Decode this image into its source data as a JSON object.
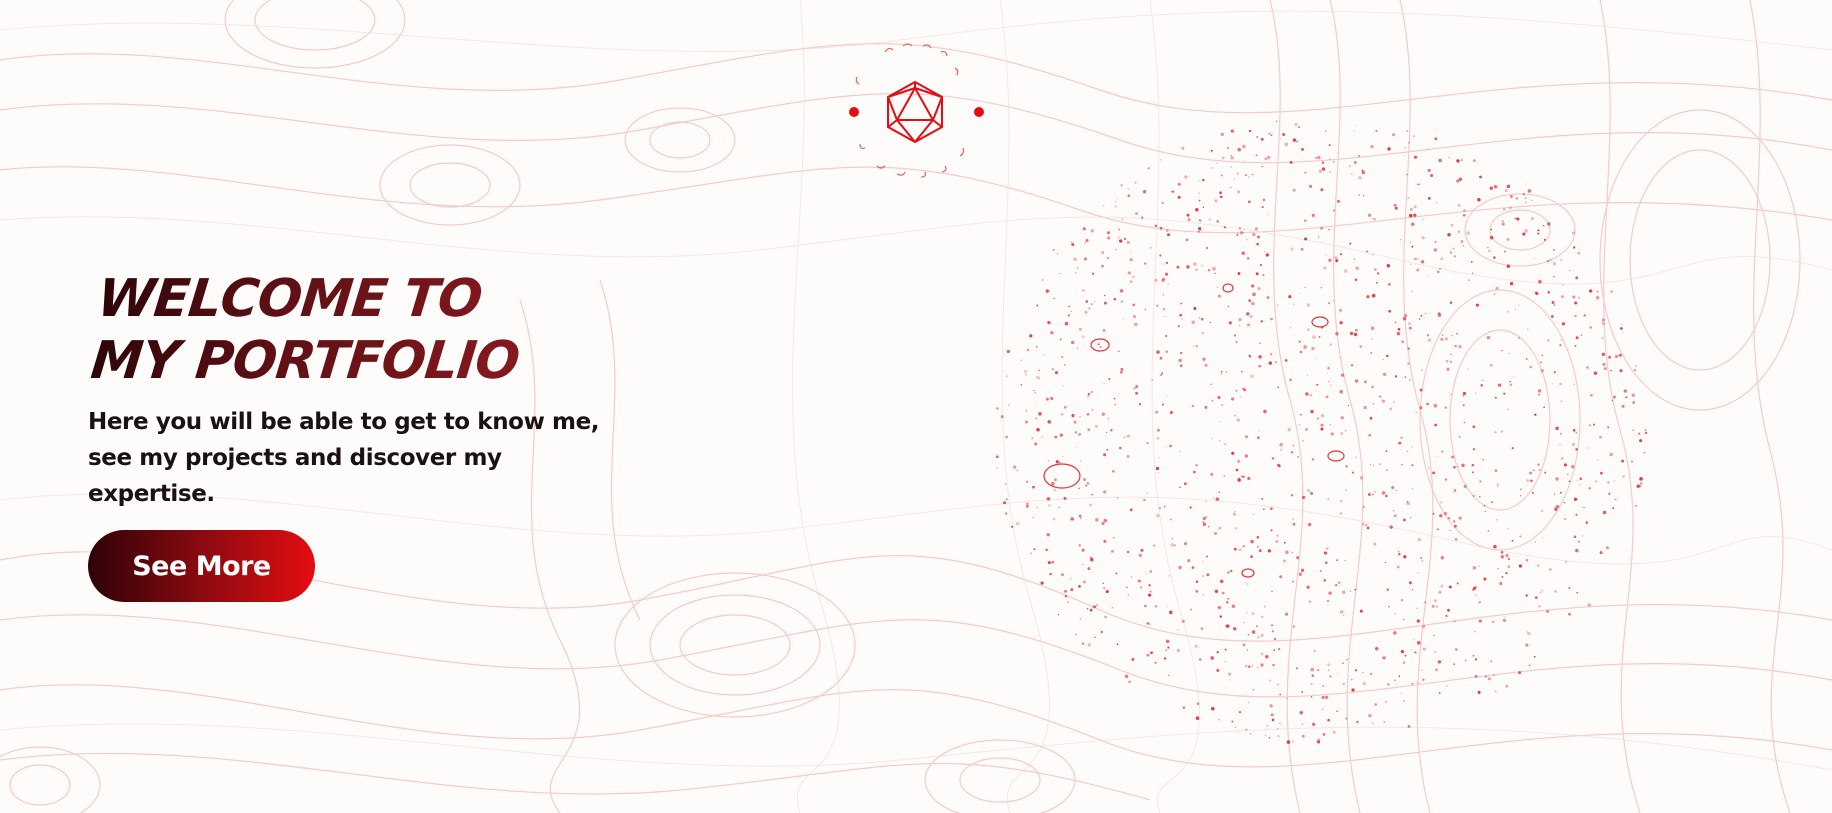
{
  "hero": {
    "title": "Welcome to my portfolio",
    "subtitle": "Here you will be able to get to know me, see my projects and discover my expertise."
  },
  "cta": {
    "label": "See More"
  },
  "logo": {
    "icon": "icosahedron-icon"
  },
  "colors": {
    "accent": "#e50c12",
    "dark": "#2e0207",
    "contour": "#f3b7b7",
    "background": "#fefbfb"
  }
}
